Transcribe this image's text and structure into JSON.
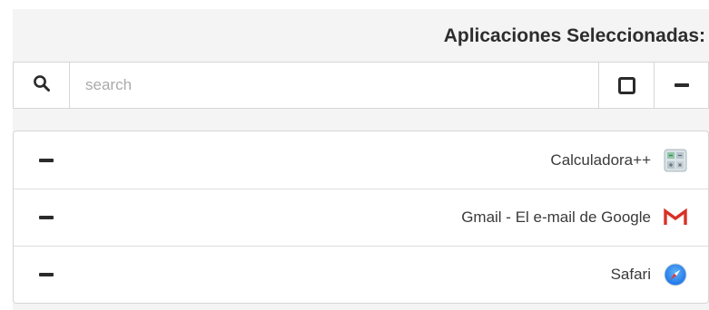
{
  "header": {
    "title": "Aplicaciones Seleccionadas:"
  },
  "search": {
    "placeholder": "search",
    "value": "",
    "icon": "search-icon"
  },
  "toolbar": {
    "select_all_icon": "square-icon",
    "remove_all_icon": "minus-icon"
  },
  "apps": [
    {
      "label": "Calculadora++",
      "icon": "calculator-icon"
    },
    {
      "label": "Gmail - El e-mail de Google",
      "icon": "gmail-icon",
      "color": "#d93025"
    },
    {
      "label": "Safari",
      "icon": "safari-compass-icon",
      "color": "#1b73e8"
    }
  ],
  "colors": {
    "panel_background": "#f4f4f4",
    "border": "#d6d6d6",
    "text": "#3a3a3a"
  }
}
